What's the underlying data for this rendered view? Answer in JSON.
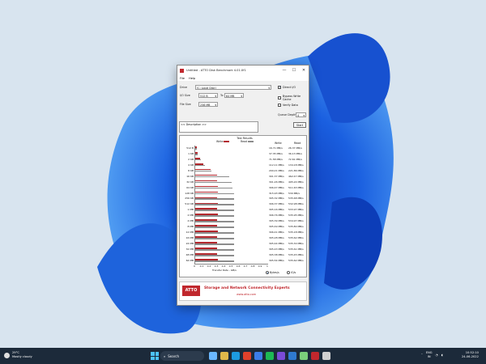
{
  "window": {
    "title": "Untitled - ATTO Disk Benchmark 4.01.0f1",
    "menu": [
      "File",
      "Help"
    ],
    "controls": {
      "minimize": "—",
      "maximize": "☐",
      "close": "✕"
    }
  },
  "settings": {
    "drive_label": "Drive",
    "drive_value": "[C: Local Disk]",
    "io_size_label": "I/O Size",
    "io_size_from": "512 B",
    "io_size_to_label": "To",
    "io_size_to": "64 MB",
    "file_size_label": "File Size",
    "file_size_value": "256 MB",
    "direct_io": "Direct I/O",
    "bypass_write_cache": "Bypass Write Cache",
    "verify_data": "Verify Data",
    "queue_depth_label": "Queue Depth",
    "queue_depth_value": "4",
    "start_button": "Start",
    "description_placeholder": "<< Description >>"
  },
  "results": {
    "header": "Test Results",
    "legend_write": "Write",
    "legend_read": "Read",
    "col_write": "Write",
    "col_read": "Read",
    "x_axis_label": "Transfer Rate - GB/s",
    "x_ticks": [
      "0",
      "0.1",
      "0.2",
      "0.3",
      "0.4",
      "0.5",
      "0.6",
      "0.7",
      "0.8",
      "0.9",
      "1"
    ],
    "unit_bytes": "Bytes/s",
    "unit_io": "IO/s",
    "rows": [
      {
        "size": "512 B",
        "write": "16.71 MB/s",
        "read": "26.37 MB/s",
        "w": 0.017,
        "r": 0.026
      },
      {
        "size": "1 KB",
        "write": "37.35 MB/s",
        "read": "36.13 MB/s",
        "w": 0.037,
        "r": 0.036
      },
      {
        "size": "2 KB",
        "write": "71.58 MB/s",
        "read": "72.61 MB/s",
        "w": 0.072,
        "r": 0.073
      },
      {
        "size": "4 KB",
        "write": "112.11 MB/s",
        "read": "134.18 MB/s",
        "w": 0.112,
        "r": 0.134
      },
      {
        "size": "8 KB",
        "write": "209.21 MB/s",
        "read": "221.86 MB/s",
        "w": 0.209,
        "r": 0.222
      },
      {
        "size": "16 KB",
        "write": "301.37 MB/s",
        "read": "462.47 MB/s",
        "w": 0.301,
        "r": 0.462
      },
      {
        "size": "32 KB",
        "write": "301.26 MB/s",
        "read": "495.24 MB/s",
        "w": 0.301,
        "r": 0.495
      },
      {
        "size": "64 KB",
        "write": "306.47 MB/s",
        "read": "511.63 MB/s",
        "w": 0.306,
        "r": 0.512
      },
      {
        "size": "128 KB",
        "write": "315.93 MB/s",
        "read": "530 MB/s",
        "w": 0.316,
        "r": 0.53
      },
      {
        "size": "256 KB",
        "write": "305.32 MB/s",
        "read": "535.68 MB/s",
        "w": 0.305,
        "r": 0.536
      },
      {
        "size": "512 KB",
        "write": "306.37 MB/s",
        "read": "532.98 MB/s",
        "w": 0.306,
        "r": 0.533
      },
      {
        "size": "1 MB",
        "write": "305.16 MB/s",
        "read": "533.97 MB/s",
        "w": 0.305,
        "r": 0.534
      },
      {
        "size": "2 MB",
        "write": "306.76 MB/s",
        "read": "535.95 MB/s",
        "w": 0.307,
        "r": 0.536
      },
      {
        "size": "4 MB",
        "write": "305.39 MB/s",
        "read": "534.97 MB/s",
        "w": 0.305,
        "r": 0.535
      },
      {
        "size": "8 MB",
        "write": "305.49 MB/s",
        "read": "535.80 MB/s",
        "w": 0.305,
        "r": 0.536
      },
      {
        "size": "12 MB",
        "write": "306.41 MB/s",
        "read": "535.18 MB/s",
        "w": 0.306,
        "r": 0.535
      },
      {
        "size": "16 MB",
        "write": "305.28 MB/s",
        "read": "535.62 MB/s",
        "w": 0.305,
        "r": 0.536
      },
      {
        "size": "24 MB",
        "write": "305.44 MB/s",
        "read": "535.30 MB/s",
        "w": 0.305,
        "r": 0.535
      },
      {
        "size": "32 MB",
        "write": "305.43 MB/s",
        "read": "535.61 MB/s",
        "w": 0.305,
        "r": 0.536
      },
      {
        "size": "48 MB",
        "write": "305.38 MB/s",
        "read": "535.45 MB/s",
        "w": 0.305,
        "r": 0.535
      },
      {
        "size": "64 MB",
        "write": "305.54 MB/s",
        "read": "535.62 MB/s",
        "w": 0.306,
        "r": 0.536
      }
    ]
  },
  "banner": {
    "logo": "ATTO",
    "tagline": "Storage and Network Connectivity Experts",
    "url": "www.atto.com"
  },
  "taskbar": {
    "weather_temp": "29°C",
    "weather_desc": "Mostly cloudy",
    "search_label": "Search",
    "lang_top": "ENG",
    "lang_bottom": "IN",
    "time": "10:52:10",
    "date": "24-06-2022"
  },
  "colors": {
    "write_bar": "#b3272d",
    "read_bar": "#8c8c8c",
    "accent": "#c0272d"
  }
}
